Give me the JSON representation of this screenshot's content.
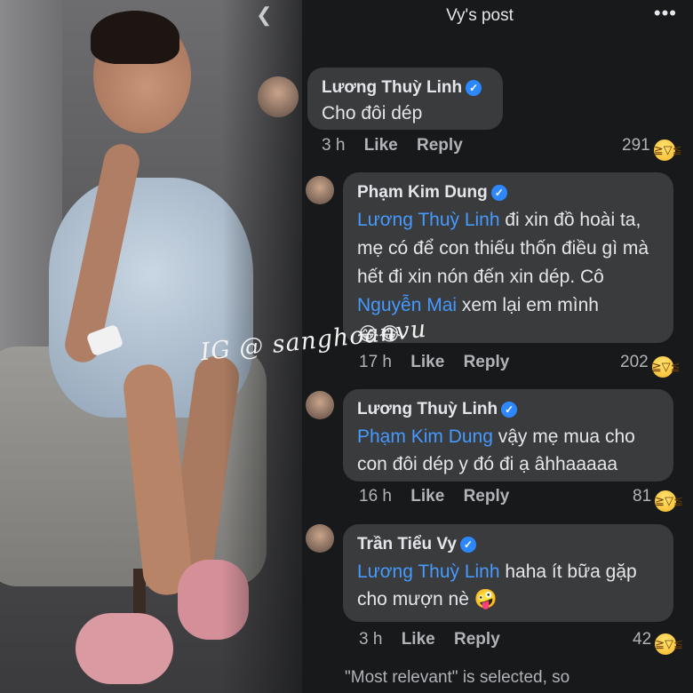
{
  "header": {
    "title": "Vy's post",
    "back_icon": "chevron-left-icon",
    "more_icon": "more-dots-icon"
  },
  "watermark": "IG @ sanghoanvu",
  "comments": [
    {
      "name": "Lương Thuỳ Linh",
      "text_parts": [
        "Cho đôi dép"
      ],
      "time": "3 h",
      "like_label": "Like",
      "reply_label": "Reply",
      "reactions": "291"
    },
    {
      "name": "Phạm Kim Dung",
      "mention": "Lương Thuỳ Linh",
      "text_1": " đi xin đồ hoài ta, mẹ có để con thiếu thốn điều gì mà hết đi xin nón đến xin dép. Cô ",
      "mention_2": "Nguyễn Mai",
      "text_2": " xem lại em mình",
      "emoji": "😂😂",
      "time": "17 h",
      "like_label": "Like",
      "reply_label": "Reply",
      "reactions": "202"
    },
    {
      "name": "Lương Thuỳ Linh",
      "mention": "Phạm Kim Dung",
      "text_1": " vậy mẹ mua cho con đôi dép y đó đi ạ âhhaaaaa",
      "time": "16 h",
      "like_label": "Like",
      "reply_label": "Reply",
      "reactions": "81"
    },
    {
      "name": "Trần Tiểu Vy",
      "mention": "Lương Thuỳ Linh",
      "text_1": " haha ít bữa gặp cho mượn nè",
      "emoji": "🤪",
      "time": "3 h",
      "like_label": "Like",
      "reply_label": "Reply",
      "reactions": "42"
    }
  ],
  "footer_note": "\"Most relevant\" is selected, so",
  "colors": {
    "background": "#18191a",
    "bubble": "#3a3b3c",
    "mention": "#4599ff",
    "verified": "#2d88ff"
  }
}
